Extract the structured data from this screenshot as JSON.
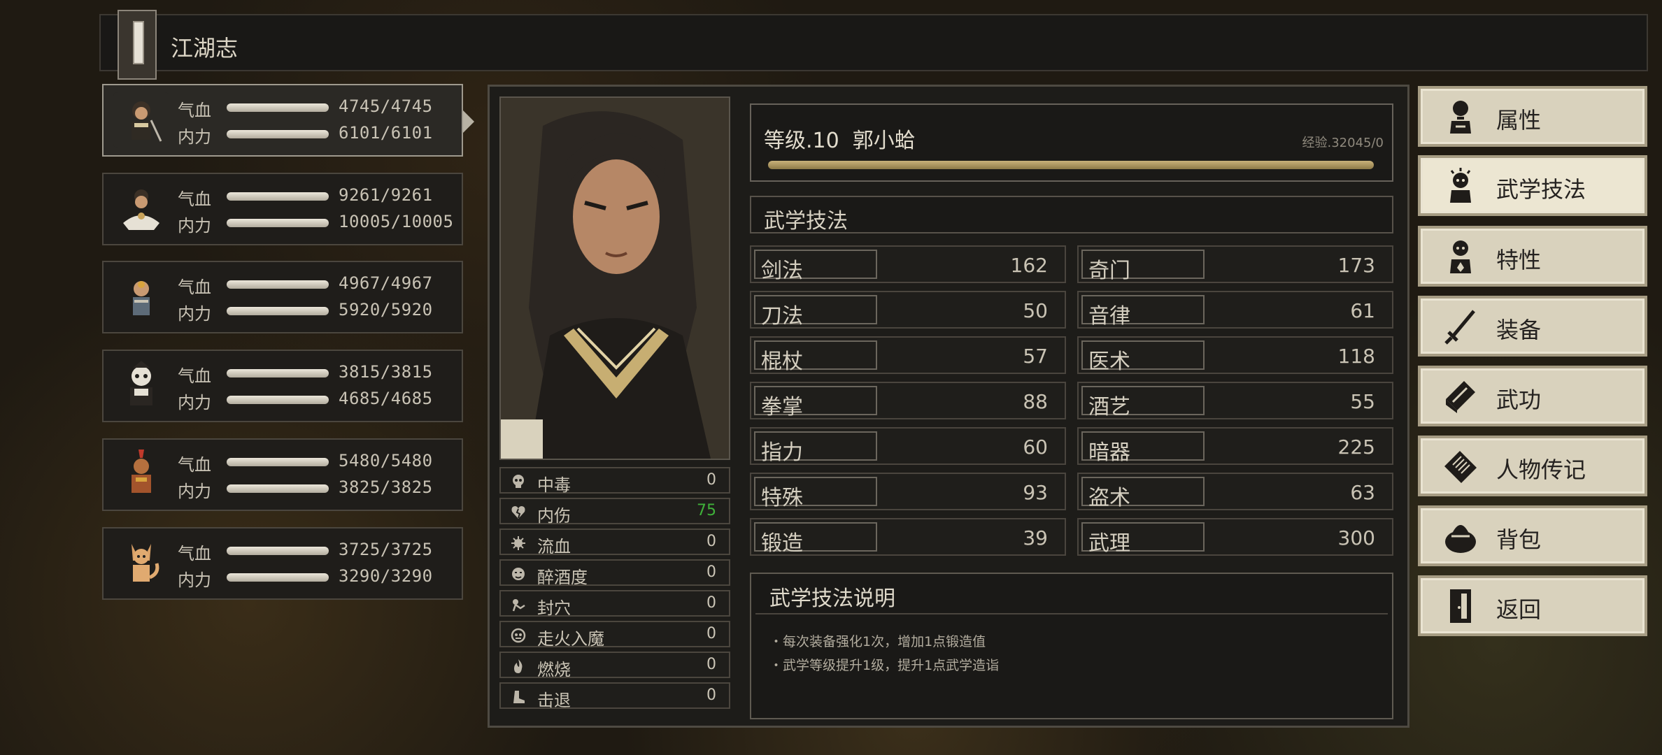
{
  "header": {
    "title": "江湖志",
    "icon": "book-icon"
  },
  "party": {
    "labels": {
      "hp": "气血",
      "mp": "内力"
    },
    "members": [
      {
        "hp": "4745/4745",
        "mp": "6101/6101",
        "active": true
      },
      {
        "hp": "9261/9261",
        "mp": "10005/10005"
      },
      {
        "hp": "4967/4967",
        "mp": "5920/5920"
      },
      {
        "hp": "3815/3815",
        "mp": "4685/4685"
      },
      {
        "hp": "5480/5480",
        "mp": "3825/3825"
      },
      {
        "hp": "3725/3725",
        "mp": "3290/3290"
      }
    ]
  },
  "status": [
    {
      "name": "中毒",
      "value": "0",
      "icon": "skull-icon"
    },
    {
      "name": "内伤",
      "value": "75",
      "icon": "broken-heart-icon",
      "highlight": "#3fb13a"
    },
    {
      "name": "流血",
      "value": "0",
      "icon": "blood-icon"
    },
    {
      "name": "醉酒度",
      "value": "0",
      "icon": "drunk-icon"
    },
    {
      "name": "封穴",
      "value": "0",
      "icon": "acupoint-icon"
    },
    {
      "name": "走火入魔",
      "value": "0",
      "icon": "demon-icon"
    },
    {
      "name": "燃烧",
      "value": "0",
      "icon": "fire-icon"
    },
    {
      "name": "击退",
      "value": "0",
      "icon": "boot-icon"
    }
  ],
  "character": {
    "level": "等级.10",
    "name": "郭小蛤",
    "exp": "经验.32045/0"
  },
  "skills": {
    "header": "武学技法",
    "left": [
      {
        "name": "剑法",
        "value": "162"
      },
      {
        "name": "刀法",
        "value": "50"
      },
      {
        "name": "棍杖",
        "value": "57"
      },
      {
        "name": "拳掌",
        "value": "88"
      },
      {
        "name": "指力",
        "value": "60"
      },
      {
        "name": "特殊",
        "value": "93"
      },
      {
        "name": "锻造",
        "value": "39"
      }
    ],
    "right": [
      {
        "name": "奇门",
        "value": "173"
      },
      {
        "name": "音律",
        "value": "61"
      },
      {
        "name": "医术",
        "value": "118"
      },
      {
        "name": "酒艺",
        "value": "55"
      },
      {
        "name": "暗器",
        "value": "225"
      },
      {
        "name": "盗术",
        "value": "63"
      },
      {
        "name": "武理",
        "value": "300"
      }
    ]
  },
  "description": {
    "title": "武学技法说明",
    "lines": [
      "・每次装备强化1次，增加1点锻造值",
      "・武学等级提升1级，提升1点武学造诣"
    ]
  },
  "menu": [
    {
      "label": "属性",
      "icon": "person-icon"
    },
    {
      "label": "武学技法",
      "icon": "martial-skill-icon",
      "active": true
    },
    {
      "label": "特性",
      "icon": "trait-icon"
    },
    {
      "label": "装备",
      "icon": "sword-icon"
    },
    {
      "label": "武功",
      "icon": "manual-icon"
    },
    {
      "label": "人物传记",
      "icon": "scroll-icon"
    },
    {
      "label": "背包",
      "icon": "bag-icon"
    },
    {
      "label": "返回",
      "icon": "door-icon"
    }
  ],
  "colors": {
    "exp_bar": "#c9b27a",
    "menu_bg": "#d9d2bd",
    "panel_bg": "#1d1c19",
    "highlight_green": "#3fb13a"
  }
}
